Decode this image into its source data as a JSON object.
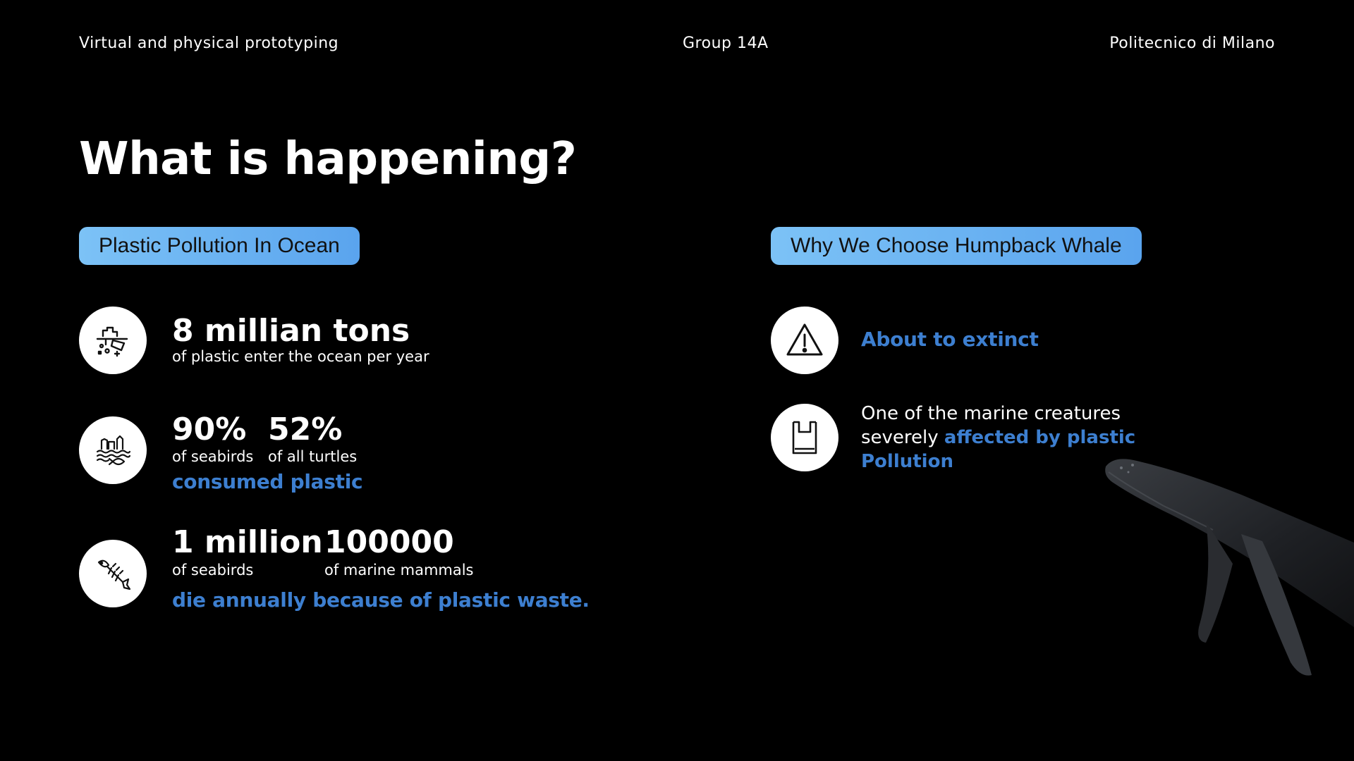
{
  "header": {
    "course": "Virtual and physical prototyping",
    "group": "Group 14A",
    "university": "Politecnico di Milano"
  },
  "title": "What is happening?",
  "left_section": {
    "label": "Plastic Pollution In Ocean",
    "stat1": {
      "icon": "plastic-debris-icon",
      "value": "8 millian tons",
      "caption": "of plastic enter the ocean per year"
    },
    "stat2": {
      "icon": "plastic-waves-fish-icon",
      "value_a": "90%",
      "caption_a": "of seabirds",
      "value_b": "52%",
      "caption_b": "of all turtles",
      "highlight": "consumed plastic"
    },
    "stat3": {
      "icon": "fish-skeleton-icon",
      "value_a": "1 million",
      "caption_a": "of seabirds",
      "value_b": "100000",
      "caption_b": "of marine mammals",
      "highlight": "die annually because of plastic waste."
    }
  },
  "right_section": {
    "label": "Why We Choose Humpback Whale",
    "reason1": {
      "icon": "warning-icon",
      "text": "About to extinct"
    },
    "reason2": {
      "icon": "plastic-bag-icon",
      "text_plain": "One of the marine creatures severely ",
      "text_highlight": "affected by plastic Pollution"
    }
  },
  "colors": {
    "background": "#000000",
    "accent_blue": "#3d7fd0",
    "pill_start": "#7cc2f6",
    "pill_end": "#5aa4ee"
  }
}
